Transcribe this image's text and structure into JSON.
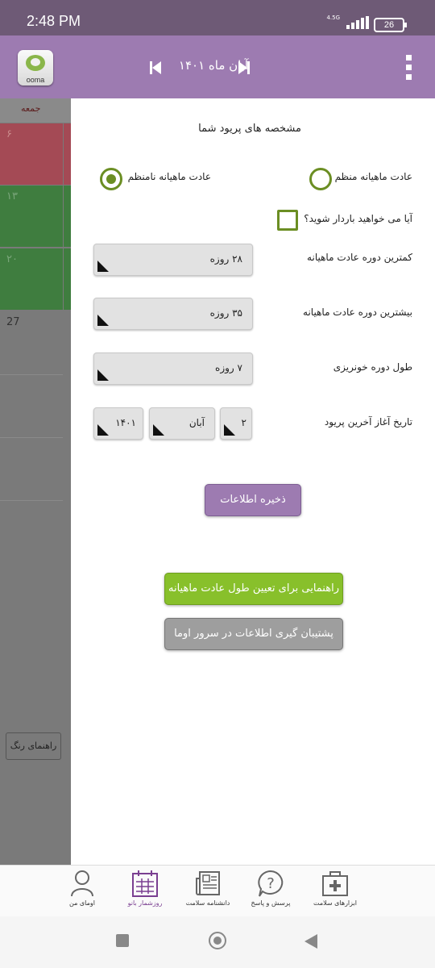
{
  "status": {
    "time": "2:48 PM",
    "network": "4.5G",
    "battery": "26"
  },
  "header": {
    "logo_text": "ooma",
    "month_title": "آبان ماه ۱۴۰۱"
  },
  "calendar": {
    "weekday": "جمعه",
    "days": [
      "۶",
      "۱۳",
      "۲۰",
      "27"
    ],
    "colors": {
      "red": "#a44a55",
      "green": "#3f7d3f",
      "gray": "#7a7a7a"
    },
    "color_guide_label": "راهنمای رنگ"
  },
  "form": {
    "title": "مشخصه های پریود شما",
    "regular_label": "عادت ماهیانه منظم",
    "irregular_label": "عادت ماهیانه نامنظم",
    "selected_option": "irregular",
    "pregnant_question": "آیا می خواهید باردار شوید؟",
    "min_cycle_label": "کمترین دوره عادت ماهیانه",
    "min_cycle_value": "۲۸ روزه",
    "max_cycle_label": "بیشترین دوره عادت ماهیانه",
    "max_cycle_value": "۳۵ روزه",
    "bleeding_label": "طول دوره خونریزی",
    "bleeding_value": "۷ روزه",
    "last_start_label": "تاریخ آغاز آخرین پریود",
    "day_value": "۲",
    "month_value": "آبان",
    "year_value": "۱۴۰۱",
    "save_label": "ذخیره اطلاعات",
    "guide_label": "راهنمایی برای تعیین طول عادت ماهیانه",
    "backup_label": "پشتیبان گیری اطلاعات در سرور اوما"
  },
  "bottom_nav": [
    {
      "label": "اومای من",
      "icon": "user-icon"
    },
    {
      "label": "روزشمار بانو",
      "icon": "calendar-icon",
      "active": true
    },
    {
      "label": "دانشنامه سلامت",
      "icon": "newspaper-icon"
    },
    {
      "label": "پرسش و پاسخ",
      "icon": "question-icon"
    },
    {
      "label": "ابزارهای سلامت",
      "icon": "medical-kit-icon"
    }
  ],
  "colors": {
    "appbar": "#9d7bb1",
    "accent_green": "#88c02b",
    "radio_green": "#6b8e23"
  }
}
